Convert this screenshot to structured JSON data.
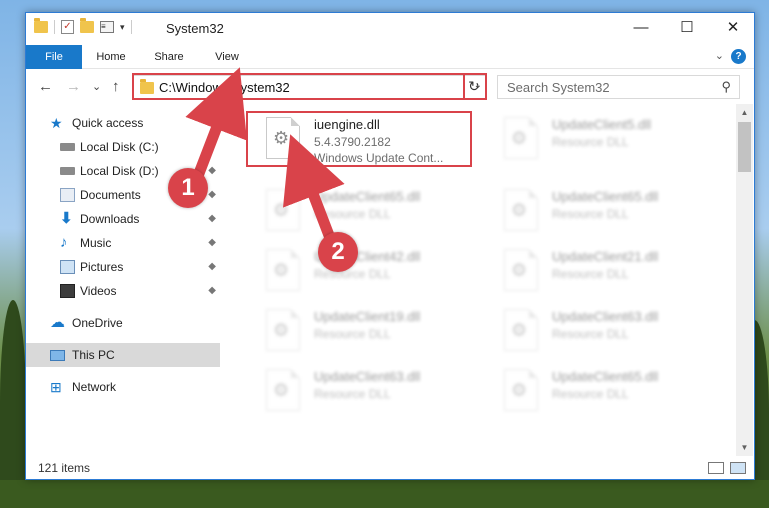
{
  "window": {
    "title": "System32",
    "minimize": "—",
    "maximize": "☐",
    "close": "✕"
  },
  "ribbon": {
    "tabs": [
      "File",
      "Home",
      "Share",
      "View"
    ],
    "help": "?",
    "collapse": "⌄"
  },
  "navbar": {
    "back": "←",
    "forward": "→",
    "recent": "⌄",
    "up": "↑",
    "address": "C:\\Windows\\System32",
    "address_dropdown": "⌄",
    "refresh": "↻",
    "search_placeholder": "Search System32",
    "search_icon": "⚲"
  },
  "sidebar": {
    "items": [
      {
        "label": "Quick access",
        "icon": "star-icon"
      },
      {
        "label": "Local Disk (C:)",
        "icon": "drive-icon",
        "pinned": true
      },
      {
        "label": "Local Disk (D:)",
        "icon": "drive-icon",
        "pinned": true
      },
      {
        "label": "Documents",
        "icon": "documents-icon",
        "pinned": true
      },
      {
        "label": "Downloads",
        "icon": "download-icon",
        "pinned": true
      },
      {
        "label": "Music",
        "icon": "music-icon",
        "pinned": true
      },
      {
        "label": "Pictures",
        "icon": "pictures-icon",
        "pinned": true
      },
      {
        "label": "Videos",
        "icon": "videos-icon",
        "pinned": true
      },
      {
        "label": "OneDrive",
        "icon": "cloud-icon"
      },
      {
        "label": "This PC",
        "icon": "computer-icon",
        "selected": true
      },
      {
        "label": "Network",
        "icon": "network-icon"
      }
    ],
    "pin_glyph": "📌"
  },
  "files": [
    {
      "name": "iuengine.dll",
      "version": "5.4.3790.2182",
      "desc": "Windows Update Cont...",
      "highlighted": true
    },
    {
      "name": "UpdateClient5.dll",
      "desc": "Resource DLL"
    },
    {
      "name": "UpdateClient65.dll",
      "desc": "Resource DLL"
    },
    {
      "name": "UpdateClient65.dll",
      "desc": "Resource DLL"
    },
    {
      "name": "UpdateClient42.dll",
      "desc": "Resource DLL"
    },
    {
      "name": "UpdateClient21.dll",
      "desc": "Resource DLL"
    },
    {
      "name": "UpdateClient19.dll",
      "desc": "Resource DLL"
    },
    {
      "name": "UpdateClient63.dll",
      "desc": "Resource DLL"
    },
    {
      "name": "UpdateClient63.dll",
      "desc": "Resource DLL"
    },
    {
      "name": "UpdateClient65.dll",
      "desc": "Resource DLL"
    }
  ],
  "status": {
    "count": "121 items"
  },
  "annotations": {
    "badge1": "1",
    "badge2": "2",
    "color": "#d9434a"
  },
  "colors": {
    "accent": "#1979ca",
    "border": "#2d7bd4",
    "selected": "#d9d9d9"
  }
}
